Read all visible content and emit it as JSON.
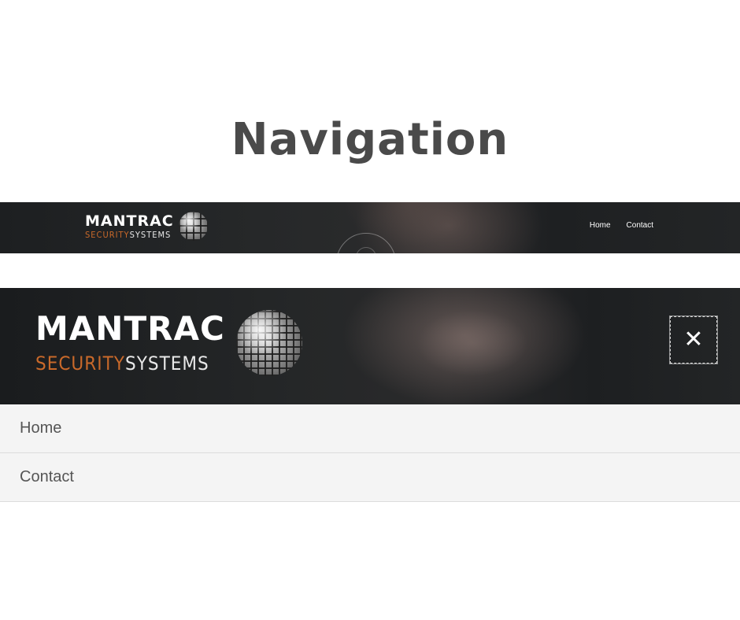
{
  "page": {
    "title": "Navigation"
  },
  "logo": {
    "main": "MANTRAC",
    "sub_security": "SECURITY",
    "sub_systems": "SYSTEMS"
  },
  "wide_nav": {
    "links": [
      {
        "label": "Home"
      },
      {
        "label": "Contact"
      }
    ]
  },
  "mobile_nav": {
    "close_icon": "close-icon",
    "menu_items": [
      {
        "label": "Home"
      },
      {
        "label": "Contact"
      }
    ]
  },
  "colors": {
    "title": "#4a4a4a",
    "accent_orange": "#c9692a",
    "hero_dark": "#1d1f21",
    "menu_bg": "#f4f4f4"
  }
}
